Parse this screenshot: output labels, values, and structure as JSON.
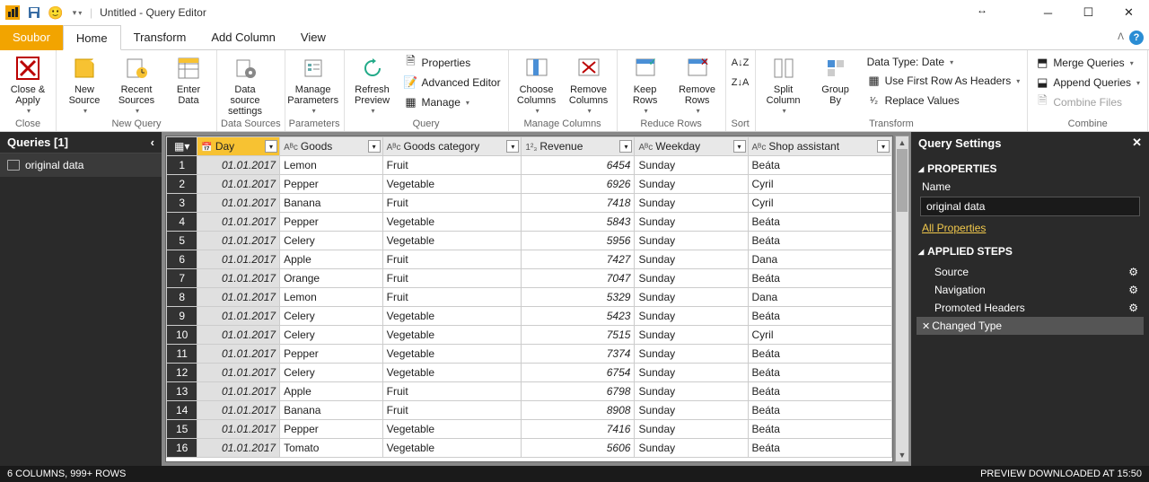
{
  "window": {
    "title": "Untitled - Query Editor"
  },
  "menu": {
    "file": "Soubor",
    "home": "Home",
    "transform": "Transform",
    "addcol": "Add Column",
    "view": "View"
  },
  "ribbon": {
    "close": {
      "btn": "Close &\nApply",
      "label": "Close"
    },
    "newquery": {
      "newsrc": "New\nSource",
      "recent": "Recent\nSources",
      "enter": "Enter\nData",
      "label": "New Query"
    },
    "datasrc": {
      "btn": "Data source\nsettings",
      "label": "Data Sources"
    },
    "params": {
      "btn": "Manage\nParameters",
      "label": "Parameters"
    },
    "query": {
      "refresh": "Refresh\nPreview",
      "props": "Properties",
      "advedit": "Advanced Editor",
      "manage": "Manage",
      "label": "Query"
    },
    "mcols": {
      "choose": "Choose\nColumns",
      "remove": "Remove\nColumns",
      "label": "Manage Columns"
    },
    "rrows": {
      "keep": "Keep\nRows",
      "remove": "Remove\nRows",
      "label": "Reduce Rows"
    },
    "sort": {
      "label": "Sort"
    },
    "transform": {
      "split": "Split\nColumn",
      "group": "Group\nBy",
      "datatype": "Data Type: Date",
      "firstrow": "Use First Row As Headers",
      "replace": "Replace Values",
      "label": "Transform"
    },
    "combine": {
      "merge": "Merge Queries",
      "append": "Append Queries",
      "files": "Combine Files",
      "label": "Combine"
    }
  },
  "queries": {
    "title": "Queries [1]",
    "items": [
      "original data"
    ]
  },
  "columns": [
    "Day",
    "Goods",
    "Goods category",
    "Revenue",
    "Weekday",
    "Shop assistant"
  ],
  "rows": [
    {
      "n": 1,
      "day": "01.01.2017",
      "goods": "Lemon",
      "cat": "Fruit",
      "rev": "6454",
      "wd": "Sunday",
      "sa": "Beáta"
    },
    {
      "n": 2,
      "day": "01.01.2017",
      "goods": "Pepper",
      "cat": "Vegetable",
      "rev": "6926",
      "wd": "Sunday",
      "sa": "Cyril"
    },
    {
      "n": 3,
      "day": "01.01.2017",
      "goods": "Banana",
      "cat": "Fruit",
      "rev": "7418",
      "wd": "Sunday",
      "sa": "Cyril"
    },
    {
      "n": 4,
      "day": "01.01.2017",
      "goods": "Pepper",
      "cat": "Vegetable",
      "rev": "5843",
      "wd": "Sunday",
      "sa": "Beáta"
    },
    {
      "n": 5,
      "day": "01.01.2017",
      "goods": "Celery",
      "cat": "Vegetable",
      "rev": "5956",
      "wd": "Sunday",
      "sa": "Beáta"
    },
    {
      "n": 6,
      "day": "01.01.2017",
      "goods": "Apple",
      "cat": "Fruit",
      "rev": "7427",
      "wd": "Sunday",
      "sa": "Dana"
    },
    {
      "n": 7,
      "day": "01.01.2017",
      "goods": "Orange",
      "cat": "Fruit",
      "rev": "7047",
      "wd": "Sunday",
      "sa": "Beáta"
    },
    {
      "n": 8,
      "day": "01.01.2017",
      "goods": "Lemon",
      "cat": "Fruit",
      "rev": "5329",
      "wd": "Sunday",
      "sa": "Dana"
    },
    {
      "n": 9,
      "day": "01.01.2017",
      "goods": "Celery",
      "cat": "Vegetable",
      "rev": "5423",
      "wd": "Sunday",
      "sa": "Beáta"
    },
    {
      "n": 10,
      "day": "01.01.2017",
      "goods": "Celery",
      "cat": "Vegetable",
      "rev": "7515",
      "wd": "Sunday",
      "sa": "Cyril"
    },
    {
      "n": 11,
      "day": "01.01.2017",
      "goods": "Pepper",
      "cat": "Vegetable",
      "rev": "7374",
      "wd": "Sunday",
      "sa": "Beáta"
    },
    {
      "n": 12,
      "day": "01.01.2017",
      "goods": "Celery",
      "cat": "Vegetable",
      "rev": "6754",
      "wd": "Sunday",
      "sa": "Beáta"
    },
    {
      "n": 13,
      "day": "01.01.2017",
      "goods": "Apple",
      "cat": "Fruit",
      "rev": "6798",
      "wd": "Sunday",
      "sa": "Beáta"
    },
    {
      "n": 14,
      "day": "01.01.2017",
      "goods": "Banana",
      "cat": "Fruit",
      "rev": "8908",
      "wd": "Sunday",
      "sa": "Beáta"
    },
    {
      "n": 15,
      "day": "01.01.2017",
      "goods": "Pepper",
      "cat": "Vegetable",
      "rev": "7416",
      "wd": "Sunday",
      "sa": "Beáta"
    },
    {
      "n": 16,
      "day": "01.01.2017",
      "goods": "Tomato",
      "cat": "Vegetable",
      "rev": "5606",
      "wd": "Sunday",
      "sa": "Beáta"
    }
  ],
  "settings": {
    "title": "Query Settings",
    "props": "PROPERTIES",
    "name_label": "Name",
    "name_value": "original data",
    "all_props": "All Properties",
    "applied": "APPLIED STEPS",
    "steps": [
      "Source",
      "Navigation",
      "Promoted Headers",
      "Changed Type"
    ]
  },
  "status": {
    "left": "6 COLUMNS, 999+ ROWS",
    "right": "PREVIEW DOWNLOADED AT 15:50"
  }
}
